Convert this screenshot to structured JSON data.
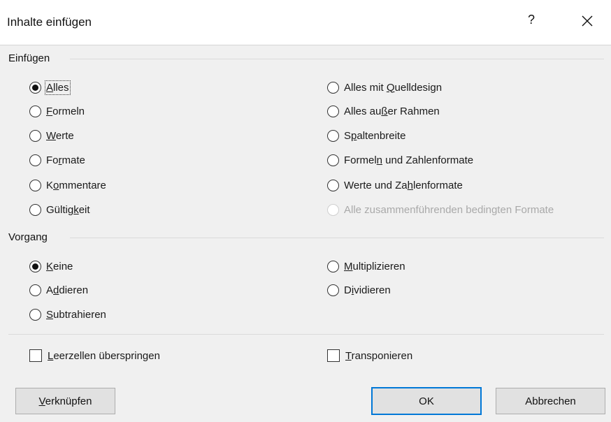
{
  "dialog": {
    "title": "Inhalte einfügen",
    "help_label": "?",
    "close_icon": "close-icon"
  },
  "einfuegen": {
    "label": "Einfügen",
    "options_left": [
      {
        "pre": "",
        "u": "A",
        "post": "lles",
        "checked": true
      },
      {
        "pre": "",
        "u": "F",
        "post": "ormeln",
        "checked": false
      },
      {
        "pre": "",
        "u": "W",
        "post": "erte",
        "checked": false
      },
      {
        "pre": "Fo",
        "u": "r",
        "post": "mate",
        "checked": false
      },
      {
        "pre": "K",
        "u": "o",
        "post": "mmentare",
        "checked": false
      },
      {
        "pre": "Gültig",
        "u": "k",
        "post": "eit",
        "checked": false
      }
    ],
    "options_right": [
      {
        "pre": "Alles mit ",
        "u": "Q",
        "post": "uelldesign",
        "checked": false,
        "disabled": false
      },
      {
        "pre": "Alles au",
        "u": "ß",
        "post": "er Rahmen",
        "checked": false,
        "disabled": false
      },
      {
        "pre": "S",
        "u": "p",
        "post": "altenbreite",
        "checked": false,
        "disabled": false
      },
      {
        "pre": "Formel",
        "u": "n",
        "post": " und Zahlenformate",
        "checked": false,
        "disabled": false
      },
      {
        "pre": "Werte und Za",
        "u": "h",
        "post": "lenformate",
        "checked": false,
        "disabled": false
      },
      {
        "pre": "Alle zusammenführenden bedingten Formate",
        "u": "",
        "post": "",
        "checked": false,
        "disabled": true
      }
    ]
  },
  "vorgang": {
    "label": "Vorgang",
    "options_left": [
      {
        "pre": "",
        "u": "K",
        "post": "eine",
        "checked": true
      },
      {
        "pre": "A",
        "u": "d",
        "post": "dieren",
        "checked": false
      },
      {
        "pre": "",
        "u": "S",
        "post": "ubtrahieren",
        "checked": false
      }
    ],
    "options_right": [
      {
        "pre": "",
        "u": "M",
        "post": "ultiplizieren",
        "checked": false
      },
      {
        "pre": "D",
        "u": "i",
        "post": "vidieren",
        "checked": false
      }
    ]
  },
  "checks": {
    "skip_blanks": {
      "pre": "",
      "u": "L",
      "post": "eerzellen überspringen",
      "checked": false
    },
    "transpose": {
      "pre": "",
      "u": "T",
      "post": "ransponieren",
      "checked": false
    }
  },
  "buttons": {
    "link": {
      "pre": "",
      "u": "V",
      "post": "erknüpfen"
    },
    "ok": "OK",
    "cancel": "Abbrechen"
  },
  "colors": {
    "accent": "#0078d7",
    "background": "#f0f0f0"
  }
}
